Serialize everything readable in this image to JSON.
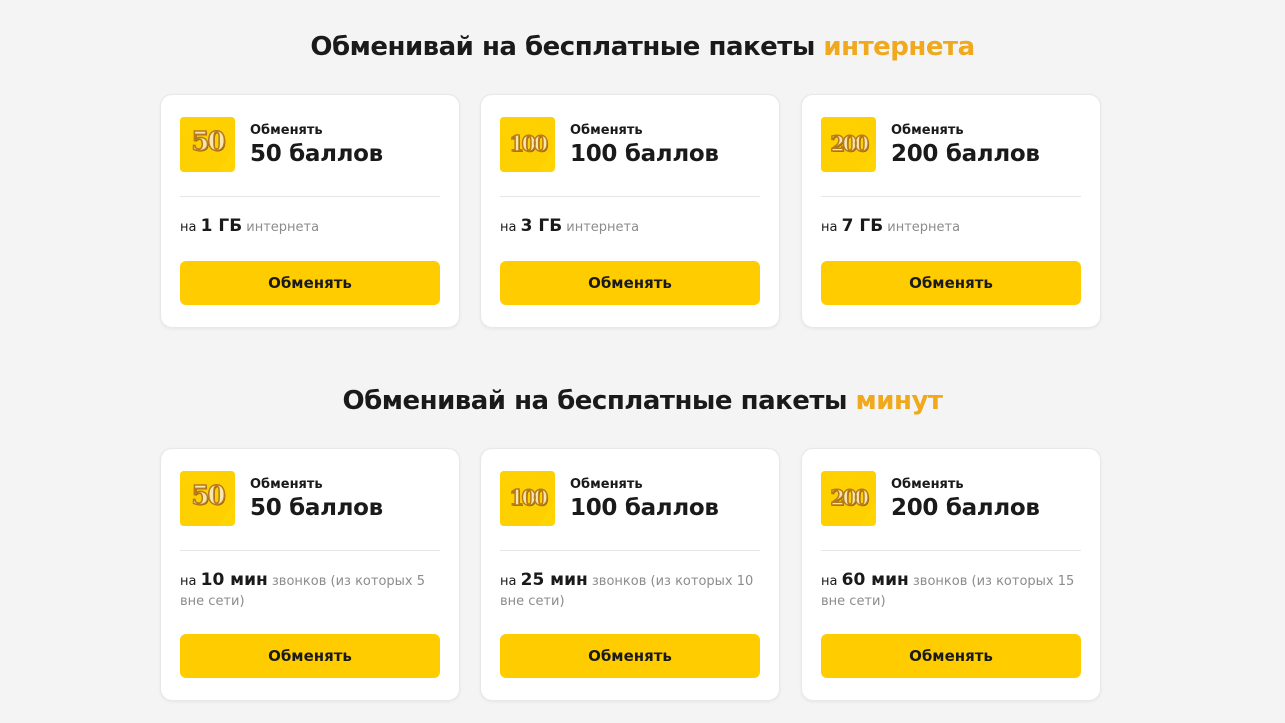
{
  "colors": {
    "accent_text": "#f0a81c",
    "button": "#ffcc00",
    "background": "#f4f4f4"
  },
  "sections": [
    {
      "title_main": "Обменивай на бесплатные пакеты ",
      "title_accent": "интернета",
      "cards": [
        {
          "badge": "50",
          "label": "Обменять",
          "points": "50 баллов",
          "prefix": "на ",
          "amount": "1 ГБ",
          "rest": " интернета",
          "button": "Обменять"
        },
        {
          "badge": "100",
          "label": "Обменять",
          "points": "100 баллов",
          "prefix": "на ",
          "amount": "3 ГБ",
          "rest": " интернета",
          "button": "Обменять"
        },
        {
          "badge": "200",
          "label": "Обменять",
          "points": "200 баллов",
          "prefix": "на ",
          "amount": "7 ГБ",
          "rest": " интернета",
          "button": "Обменять"
        }
      ]
    },
    {
      "title_main": "Обменивай на бесплатные пакеты ",
      "title_accent": "минут",
      "cards": [
        {
          "badge": "50",
          "label": "Обменять",
          "points": "50 баллов",
          "prefix": "на ",
          "amount": "10 мин",
          "rest": " звонков (из которых 5 вне сети)",
          "button": "Обменять"
        },
        {
          "badge": "100",
          "label": "Обменять",
          "points": "100 баллов",
          "prefix": "на ",
          "amount": "25 мин",
          "rest": " звонков (из которых 10 вне сети)",
          "button": "Обменять"
        },
        {
          "badge": "200",
          "label": "Обменять",
          "points": "200 баллов",
          "prefix": "на ",
          "amount": "60 мин",
          "rest": " звонков (из которых 15 вне сети)",
          "button": "Обменять"
        }
      ]
    }
  ]
}
